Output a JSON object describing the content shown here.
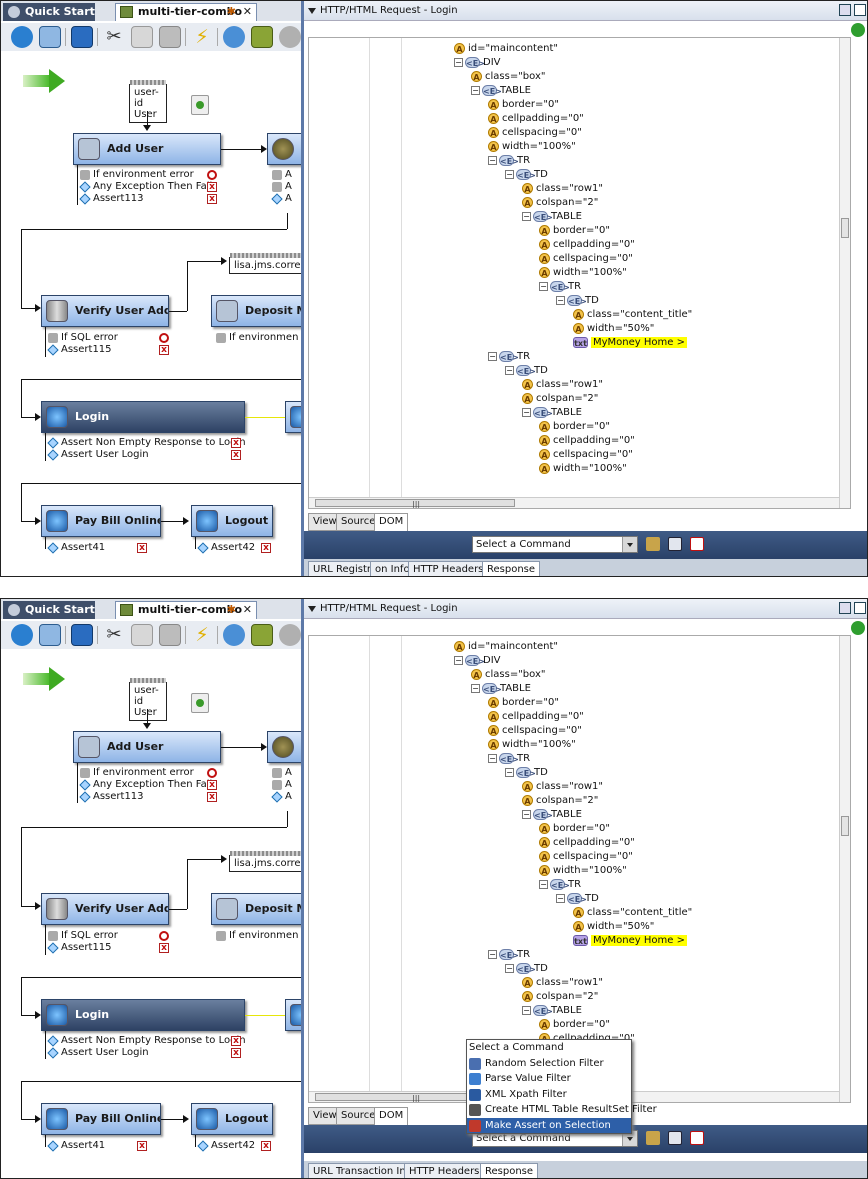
{
  "tabs": {
    "quick_start": "Quick Start",
    "doc_title": "multi-tier-combo",
    "modified_mark": "✱",
    "close": "✕"
  },
  "toolbar": {
    "icons": [
      "add-icon",
      "delete-icon",
      "back-icon",
      "cut-icon",
      "copy-icon",
      "paste-icon",
      "bolt-icon",
      "gear-icon",
      "deploy-icon",
      "more-icon"
    ]
  },
  "diagram": {
    "data_set": {
      "line1": "user-id",
      "line2": "User"
    },
    "jms": "lisa.jms.correla",
    "nodes": {
      "add_user": "Add User",
      "verify_user_added": "Verify User Added",
      "deposit": "Deposit Mo",
      "login": "Login",
      "pay_bill_online": "Pay Bill Online",
      "logout": "Logout"
    },
    "assertions": {
      "add_user": [
        "If environment error",
        "Any Exception Then Fail",
        "Assert113"
      ],
      "bean_partial": [
        "A",
        "A",
        "A"
      ],
      "verify_user_added": [
        "If SQL error",
        "Assert115"
      ],
      "deposit": [
        "If environmen"
      ],
      "login": [
        "Assert Non Empty Response to Login",
        "Assert User Login"
      ],
      "pay_bill_online": [
        "Assert41"
      ],
      "logout": [
        "Assert42"
      ]
    }
  },
  "right_panel": {
    "title": "HTTP/HTML Request - Login",
    "tree": [
      {
        "k": "A",
        "t": "id=\"maincontent\""
      },
      {
        "k": "E",
        "t": "DIV",
        "e": "-"
      },
      {
        "k": "A",
        "t": "class=\"box\""
      },
      {
        "k": "E",
        "t": "TABLE",
        "e": "-"
      },
      {
        "k": "A",
        "t": "border=\"0\""
      },
      {
        "k": "A",
        "t": "cellpadding=\"0\""
      },
      {
        "k": "A",
        "t": "cellspacing=\"0\""
      },
      {
        "k": "A",
        "t": "width=\"100%\""
      },
      {
        "k": "E",
        "t": "TR",
        "e": "-"
      },
      {
        "k": "E",
        "t": "TD",
        "e": "-"
      },
      {
        "k": "A",
        "t": "class=\"row1\""
      },
      {
        "k": "A",
        "t": "colspan=\"2\""
      },
      {
        "k": "E",
        "t": "TABLE",
        "e": "-"
      },
      {
        "k": "A",
        "t": "border=\"0\""
      },
      {
        "k": "A",
        "t": "cellpadding=\"0\""
      },
      {
        "k": "A",
        "t": "cellspacing=\"0\""
      },
      {
        "k": "A",
        "t": "width=\"100%\""
      },
      {
        "k": "E",
        "t": "TR",
        "e": "-"
      },
      {
        "k": "E",
        "t": "TD",
        "e": "-"
      },
      {
        "k": "A",
        "t": "class=\"content_title\""
      },
      {
        "k": "A",
        "t": "width=\"50%\""
      },
      {
        "k": "T",
        "t": "MyMoney Home >",
        "hl": true
      },
      {
        "k": "E",
        "t": "TR",
        "e": "-"
      },
      {
        "k": "E",
        "t": "TD",
        "e": "-"
      },
      {
        "k": "A",
        "t": "class=\"row1\""
      },
      {
        "k": "A",
        "t": "colspan=\"2\""
      },
      {
        "k": "E",
        "t": "TABLE",
        "e": "-"
      },
      {
        "k": "A",
        "t": "border=\"0\""
      },
      {
        "k": "A",
        "t": "cellpadding=\"0\""
      },
      {
        "k": "A",
        "t": "cellspacing=\"0\""
      },
      {
        "k": "A",
        "t": "width=\"100%\""
      }
    ],
    "tree_ico_labels": {
      "E": "<E>",
      "T": "txt",
      "A": "A"
    },
    "view_tabs": [
      "View",
      "Source",
      "DOM Tree"
    ],
    "command_select": "Select a Command",
    "bottom_tabs_top": [
      "URL Registry",
      "on Info",
      "HTTP Headers",
      "Response"
    ],
    "bottom_tabs_bottom": [
      "URL Transaction Info",
      "HTTP Headers",
      "Response"
    ],
    "menu": {
      "items": [
        "Select a Command",
        "Random Selection Filter",
        "Parse Value Filter",
        "XML Xpath Filter",
        "Create HTML Table ResultSet Filter",
        "Make Assert on Selection"
      ],
      "active_index": 5,
      "partial_under_menu": "border=\"0\""
    }
  },
  "colors": {
    "accent": "#2d5fa8",
    "header": "#3f5b86",
    "highlight": "#ffff00"
  }
}
